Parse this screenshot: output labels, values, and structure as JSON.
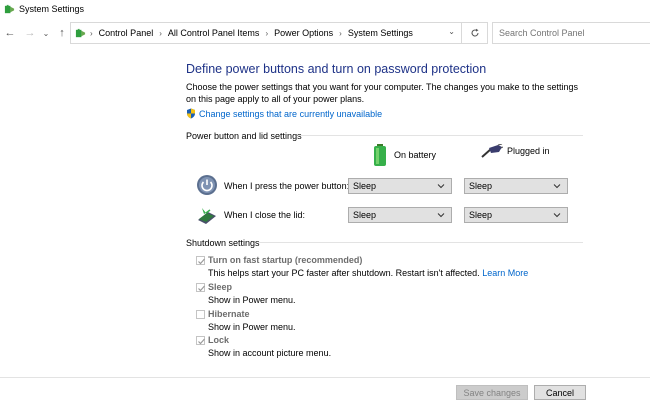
{
  "window": {
    "title": "System Settings"
  },
  "nav": {
    "breadcrumbs": [
      "Control Panel",
      "All Control Panel Items",
      "Power Options",
      "System Settings"
    ],
    "search_placeholder": "Search Control Panel"
  },
  "main": {
    "heading": "Define power buttons and turn on password protection",
    "description": "Choose the power settings that you want for your computer. The changes you make to the settings on this page apply to all of your power plans.",
    "change_link": "Change settings that are currently unavailable",
    "power_group_label": "Power button and lid settings",
    "columns": {
      "on_battery": "On battery",
      "plugged_in": "Plugged in"
    },
    "rows": [
      {
        "label": "When I press the power button:",
        "on_battery": "Sleep",
        "plugged_in": "Sleep"
      },
      {
        "label": "When I close the lid:",
        "on_battery": "Sleep",
        "plugged_in": "Sleep"
      }
    ],
    "shutdown_group_label": "Shutdown settings",
    "shutdown_options": [
      {
        "label": "Turn on fast startup (recommended)",
        "description": "This helps start your PC faster after shutdown. Restart isn't affected.",
        "link": "Learn More",
        "checked": true
      },
      {
        "label": "Sleep",
        "description": "Show in Power menu.",
        "checked": true
      },
      {
        "label": "Hibernate",
        "description": "Show in Power menu.",
        "checked": false
      },
      {
        "label": "Lock",
        "description": "Show in account picture menu.",
        "checked": true
      }
    ]
  },
  "footer": {
    "save_label": "Save changes",
    "cancel_label": "Cancel"
  },
  "colors": {
    "heading": "#1e3287",
    "link": "#0066cc",
    "disabled_text": "#6d6d6d"
  }
}
